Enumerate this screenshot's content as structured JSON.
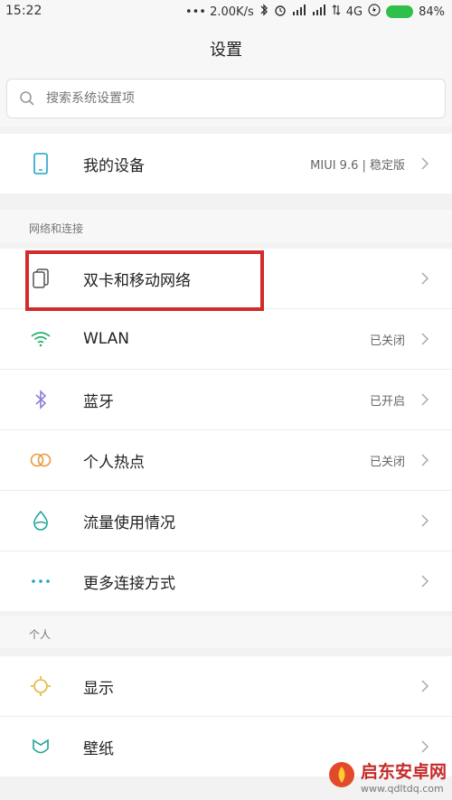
{
  "statusbar": {
    "time": "15:22",
    "speed": "••• 2.00K/s",
    "network": "4G",
    "battery": "84%"
  },
  "header": {
    "title": "设置"
  },
  "search": {
    "placeholder": "搜索系统设置项"
  },
  "device": {
    "label": "我的设备",
    "value": "MIUI 9.6 | 稳定版",
    "icon": "phone-icon"
  },
  "network_section": {
    "header": "网络和连接",
    "items": [
      {
        "label": "双卡和移动网络",
        "value": "",
        "icon": "sim-cards-icon"
      },
      {
        "label": "WLAN",
        "value": "已关闭",
        "icon": "wifi-icon"
      },
      {
        "label": "蓝牙",
        "value": "已开启",
        "icon": "bluetooth-icon"
      },
      {
        "label": "个人热点",
        "value": "已关闭",
        "icon": "hotspot-icon"
      },
      {
        "label": "流量使用情况",
        "value": "",
        "icon": "data-usage-icon"
      },
      {
        "label": "更多连接方式",
        "value": "",
        "icon": "more-dots-icon"
      }
    ]
  },
  "personal_section": {
    "header": "个人",
    "items": [
      {
        "label": "显示",
        "value": "",
        "icon": "display-icon"
      },
      {
        "label": "壁纸",
        "value": "",
        "icon": "wallpaper-icon"
      }
    ]
  },
  "watermark": {
    "title": "启东安卓网",
    "url": "www.qdltdq.com"
  },
  "colors": {
    "accent_icon": "#1fa3c8",
    "highlight_border": "#d12b2b",
    "bluetooth": "#8b7fd6",
    "hotspot": "#e89b3a",
    "display": "#e0b43a",
    "wallpaper": "#1fa39a",
    "battery": "#2fbf4a"
  }
}
